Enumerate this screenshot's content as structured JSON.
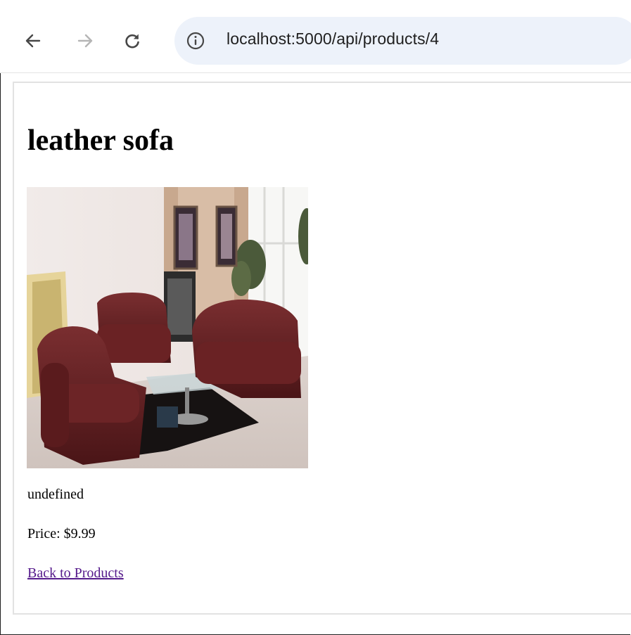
{
  "browser": {
    "url": "localhost:5000/api/products/4",
    "icons": {
      "back": "arrow-left-icon",
      "forward": "arrow-right-icon",
      "reload": "reload-icon",
      "site_info": "info-icon"
    }
  },
  "product": {
    "name": "leather sofa",
    "description": "undefined",
    "price_text": "Price: $9.99",
    "back_link": "Back to Products",
    "link_color": "#551a8b"
  }
}
